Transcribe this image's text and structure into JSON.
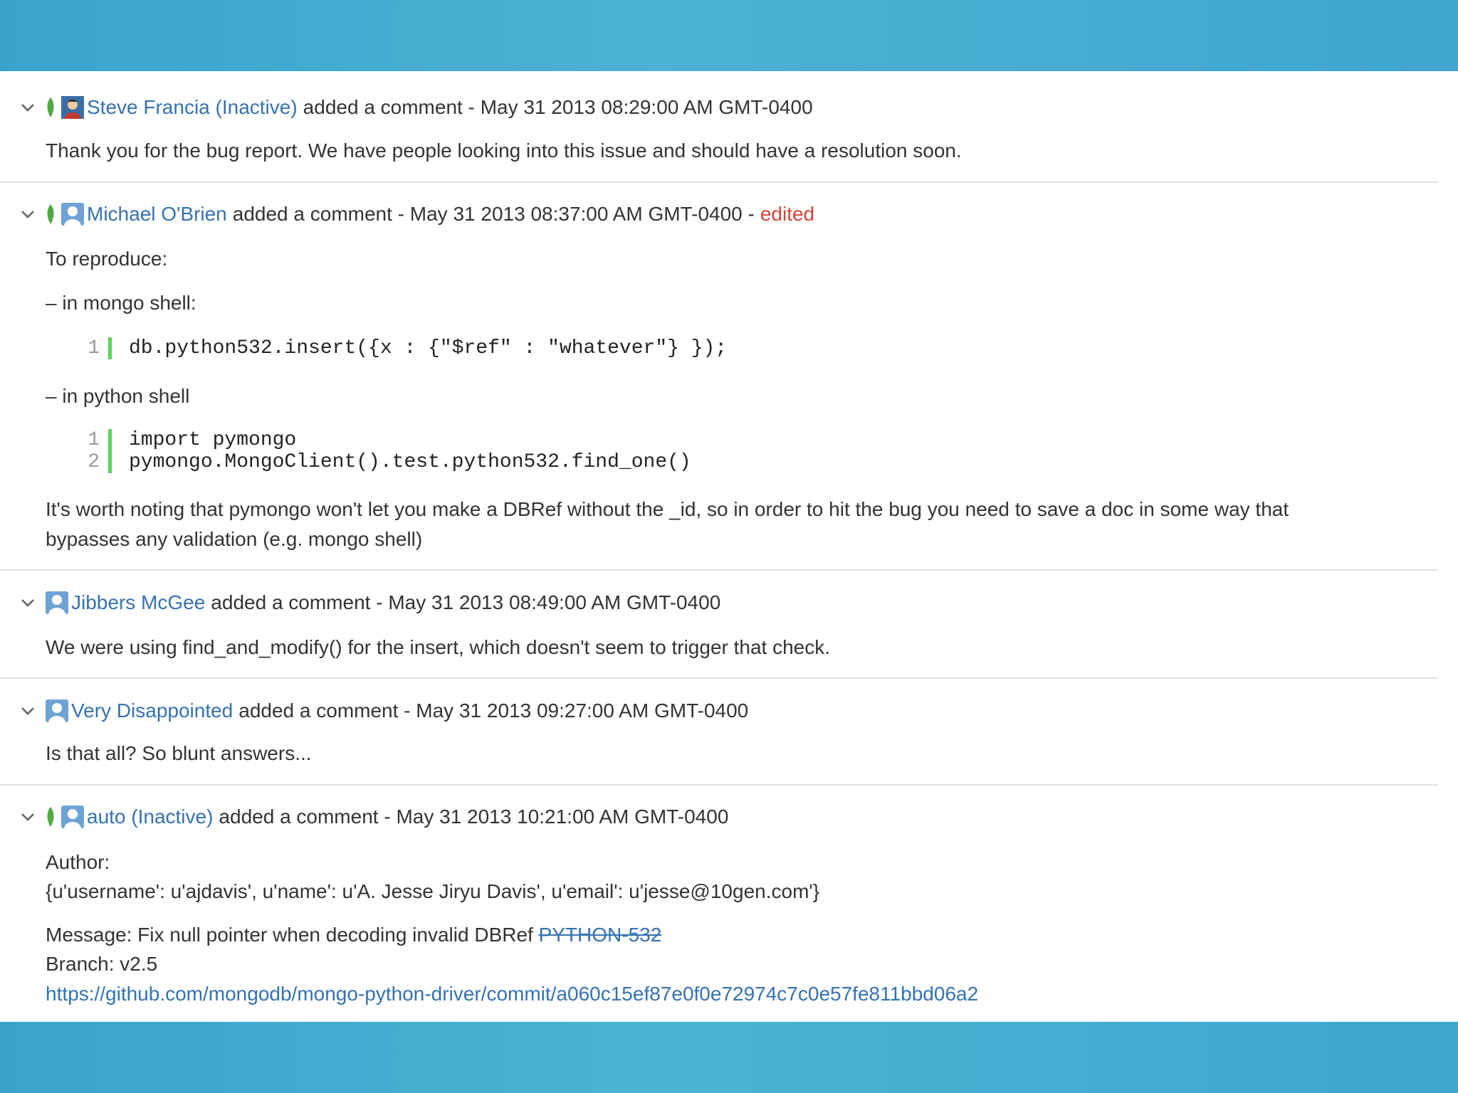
{
  "comments": [
    {
      "user": "Steve Francia (Inactive)",
      "action": "added a comment - May 31 2013 08:29:00 AM GMT-0400",
      "body": "Thank you for the bug report. We have people looking into this issue and should have a resolution soon."
    },
    {
      "user": "Michael O'Brien",
      "action": "added a comment - May 31 2013 08:37:00 AM GMT-0400 -",
      "edited": "edited",
      "intro": "To reproduce:",
      "mongo_label": "– in mongo shell:",
      "mongo_code": [
        {
          "n": "1",
          "code": "db.python532.insert({x : {\"$ref\" : \"whatever\"} });"
        }
      ],
      "python_label": "– in python shell",
      "python_code": [
        {
          "n": "1",
          "code": "import pymongo"
        },
        {
          "n": "2",
          "code": "pymongo.MongoClient().test.python532.find_one()"
        }
      ],
      "note_line1": "It's worth noting that pymongo won't let you make a DBRef without the _id, so in order to hit the bug you need to save a doc in some way that",
      "note_line2": "bypasses any validation (e.g. mongo shell)"
    },
    {
      "user": "Jibbers McGee",
      "action": "added a comment - May 31 2013 08:49:00 AM GMT-0400",
      "body": "We were using find_and_modify() for the insert, which doesn't seem to trigger that check."
    },
    {
      "user": "Very Disappointed",
      "action": "added a comment - May 31 2013 09:27:00 AM GMT-0400",
      "body": "Is that all? So blunt answers..."
    },
    {
      "user": "auto (Inactive)",
      "action": "added a comment - May 31 2013 10:21:00 AM GMT-0400",
      "author_label": "Author:",
      "author_value": "{u'username': u'ajdavis', u'name': u'A. Jesse Jiryu Davis', u'email': u'jesse@10gen.com'}",
      "message_prefix": "Message: Fix null pointer when decoding invalid DBRef",
      "issue_link": "PYTHON-532",
      "branch": "Branch: v2.5",
      "commit_url": "https://github.com/mongodb/mongo-python-driver/commit/a060c15ef87e0f0e72974c7c0e57fe811bbd06a2"
    }
  ],
  "colors": {
    "link": "#3572b0",
    "edited": "#d04437",
    "code_bar": "#5ad25a",
    "band": "#4db3d4"
  }
}
